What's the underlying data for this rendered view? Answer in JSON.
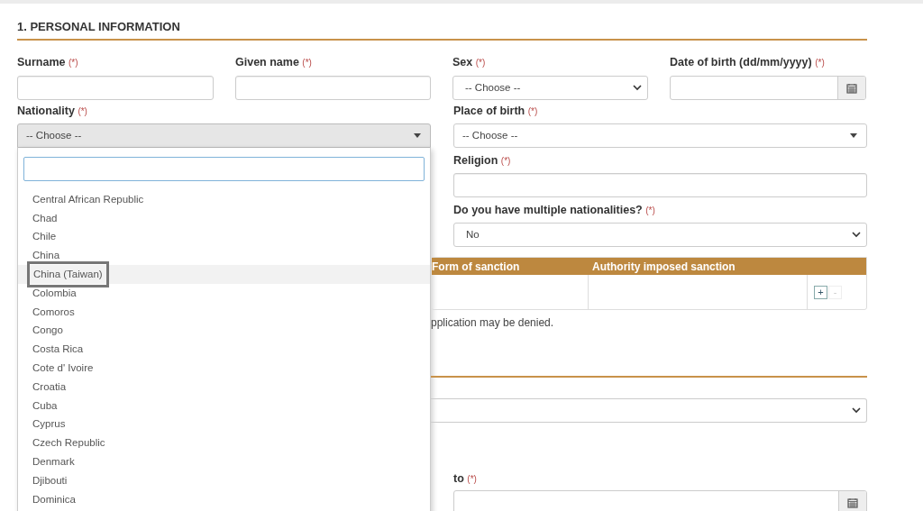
{
  "section": {
    "title": "1. PERSONAL INFORMATION"
  },
  "row_1": [
    {
      "label": "Surname",
      "required_mark": "(*)",
      "kind": "text"
    },
    {
      "label": "Given name",
      "required_mark": "(*)",
      "kind": "text"
    },
    {
      "label": "Sex",
      "required_mark": "(*)",
      "kind": "select",
      "value": "-- Choose --"
    },
    {
      "label": "Date of birth (dd/mm/yyyy)",
      "required_mark": "(*)",
      "kind": "date"
    }
  ],
  "nationality": {
    "label": "Nationality",
    "required_mark": "(*)",
    "value": "-- Choose --",
    "expanded": true,
    "options": [
      {
        "label": "Central African Republic",
        "selected": false
      },
      {
        "label": "Chad",
        "selected": false
      },
      {
        "label": "Chile",
        "selected": false
      },
      {
        "label": "China",
        "selected": false
      },
      {
        "label": "China (Taiwan)",
        "selected": true
      },
      {
        "label": "Colombia",
        "selected": false
      },
      {
        "label": "Comoros",
        "selected": false
      },
      {
        "label": "Congo",
        "selected": false
      },
      {
        "label": "Costa Rica",
        "selected": false
      },
      {
        "label": "Cote d' Ivoire",
        "selected": false
      },
      {
        "label": "Croatia",
        "selected": false
      },
      {
        "label": "Cuba",
        "selected": false
      },
      {
        "label": "Cyprus",
        "selected": false
      },
      {
        "label": "Czech Republic",
        "selected": false
      },
      {
        "label": "Denmark",
        "selected": false
      },
      {
        "label": "Djibouti",
        "selected": false
      },
      {
        "label": "Dominica",
        "selected": false
      }
    ]
  },
  "right_fields": [
    {
      "label": "Place of birth",
      "required_mark": "(*)",
      "kind": "combo",
      "value": "-- Choose --"
    },
    {
      "label": "Religion",
      "required_mark": "(*)",
      "kind": "text"
    },
    {
      "label": "Do you have multiple nationalities?",
      "required_mark": "(*)",
      "kind": "select",
      "value": "No"
    }
  ],
  "sanction_table": {
    "columns": [
      "Form of sanction",
      "Authority imposed sanction"
    ],
    "actions": [
      {
        "label": "+",
        "disabled": false
      },
      {
        "label": "-",
        "disabled": true
      }
    ]
  },
  "note": "pplication may be denied.",
  "section_2_select": {
    "kind": "select"
  },
  "to_field": {
    "label": "to",
    "required_mark": "(*)",
    "kind": "date"
  }
}
